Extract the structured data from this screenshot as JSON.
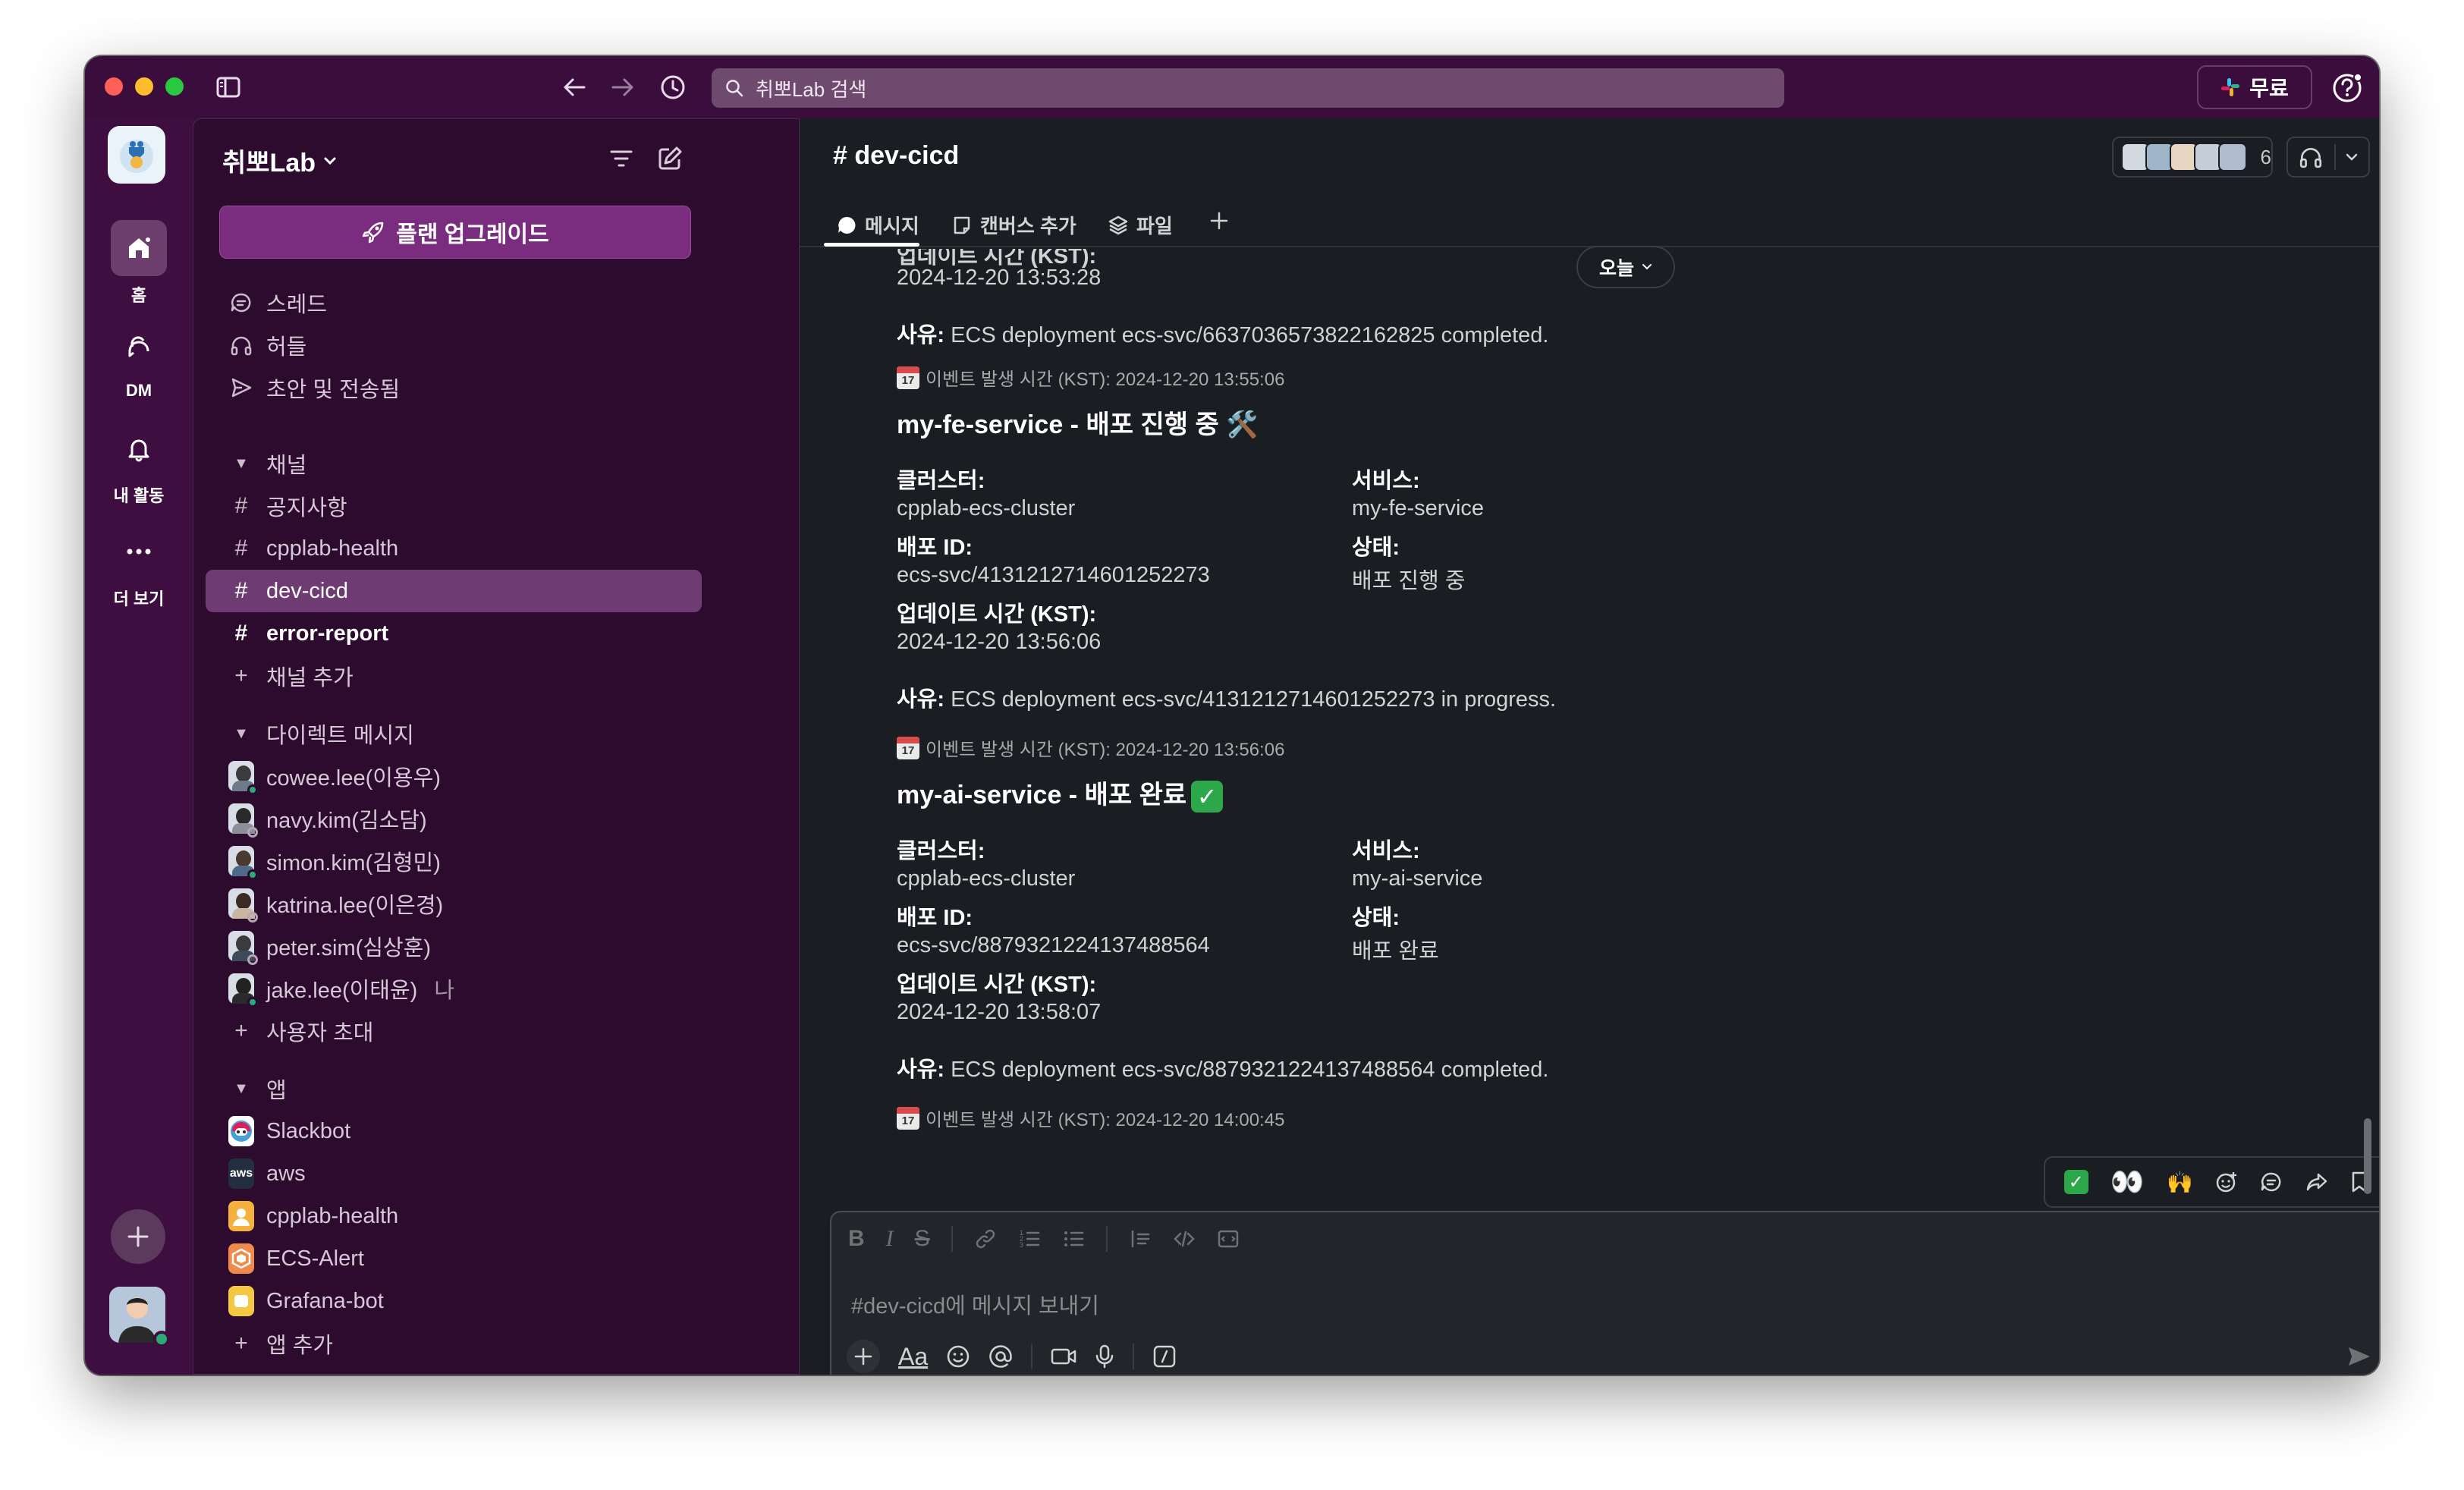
{
  "titlebar": {
    "search_placeholder": "취뽀Lab 검색",
    "free_label": "무료"
  },
  "rail": {
    "items": [
      {
        "label": "홈",
        "icon": "home-icon"
      },
      {
        "label": "DM",
        "icon": "dm-icon"
      },
      {
        "label": "내 활동",
        "icon": "bell-icon"
      },
      {
        "label": "더 보기",
        "icon": "more-icon"
      }
    ]
  },
  "sidebar": {
    "workspace_name": "취뽀Lab",
    "upgrade_label": "플랜 업그레이드",
    "nav": [
      {
        "label": "스레드",
        "icon": "threads-icon"
      },
      {
        "label": "허들",
        "icon": "headphones-icon"
      },
      {
        "label": "초안 및 전송됨",
        "icon": "send-icon"
      }
    ],
    "channels_header": "채널",
    "channels": [
      {
        "label": "공지사항"
      },
      {
        "label": "cpplab-health"
      },
      {
        "label": "dev-cicd"
      },
      {
        "label": "error-report"
      }
    ],
    "add_channel": "채널 추가",
    "dm_header": "다이렉트 메시지",
    "dms": [
      {
        "label": "cowee.lee(이용우)"
      },
      {
        "label": "navy.kim(김소담)"
      },
      {
        "label": "simon.kim(김형민)"
      },
      {
        "label": "katrina.lee(이은경)"
      },
      {
        "label": "peter.sim(심상훈)"
      },
      {
        "label": "jake.lee(이태윤)",
        "suffix": "나"
      }
    ],
    "invite_label": "사용자 초대",
    "apps_header": "앱",
    "apps": [
      {
        "label": "Slackbot"
      },
      {
        "label": "aws",
        "badge": "aws"
      },
      {
        "label": "cpplab-health"
      },
      {
        "label": "ECS-Alert"
      },
      {
        "label": "Grafana-bot"
      }
    ],
    "add_app": "앱 추가"
  },
  "channel": {
    "name": "dev-cicd",
    "member_count": "6",
    "tabs": [
      {
        "label": "메시지"
      },
      {
        "label": "캔버스 추가"
      },
      {
        "label": "파일"
      }
    ]
  },
  "feed": {
    "today_label": "오늘",
    "partial_top": "업데이트 시간 (KST):",
    "first_time": "2024-12-20 13:53:28",
    "first_reason_label": "사유:",
    "first_reason": "ECS deployment ecs-svc/6637036573822162825 completed.",
    "first_event": "이벤트 발생 시간 (KST): 2024-12-20 13:55:06",
    "block2": {
      "title": "my-fe-service - 배포 진행 중 🛠️",
      "cluster_label": "클러스터:",
      "cluster": "cpplab-ecs-cluster",
      "service_label": "서비스:",
      "service": "my-fe-service",
      "deploy_label": "배포 ID:",
      "deploy": "ecs-svc/4131212714601252273",
      "status_label": "상태:",
      "status": "배포 진행 중",
      "time_label": "업데이트 시간 (KST):",
      "time": "2024-12-20 13:56:06",
      "reason_label": "사유:",
      "reason": "ECS deployment ecs-svc/4131212714601252273 in progress.",
      "event": "이벤트 발생 시간 (KST): 2024-12-20 13:56:06"
    },
    "block3": {
      "title": "my-ai-service - 배포 완료",
      "cluster_label": "클러스터:",
      "cluster": "cpplab-ecs-cluster",
      "service_label": "서비스:",
      "service": "my-ai-service",
      "deploy_label": "배포 ID:",
      "deploy": "ecs-svc/8879321224137488564",
      "status_label": "상태:",
      "status": "배포 완료",
      "time_label": "업데이트 시간 (KST):",
      "time": "2024-12-20 13:58:07",
      "reason_label": "사유:",
      "reason": "ECS deployment ecs-svc/8879321224137488564 completed.",
      "event": "이벤트 발생 시간 (KST): 2024-12-20 14:00:45"
    },
    "calendar_day": "17"
  },
  "composer": {
    "placeholder": "#dev-cicd에 메시지 보내기",
    "aa_label": "Aa"
  },
  "colors": {
    "rail_bg": "#3f0e40",
    "sidebar_bg": "#2c0b2e",
    "active_channel": "#6f3b73",
    "upgrade_btn": "#7a2d7f",
    "main_bg": "#1a1d21"
  }
}
